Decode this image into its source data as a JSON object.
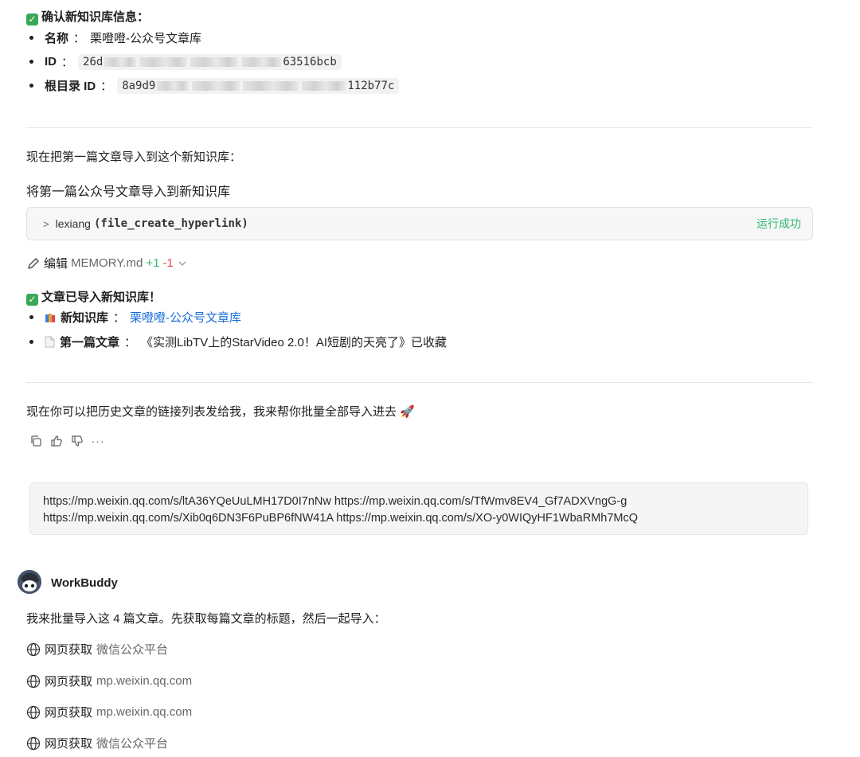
{
  "kb_info": {
    "heading": "确认新知识库信息：",
    "name_label": "名称",
    "name_value": "栗噔噔-公众号文章库",
    "id_label": "ID",
    "id_prefix": "26d",
    "id_suffix": "63516bcb",
    "root_label": "根目录 ID",
    "root_prefix": "8a9d9",
    "root_suffix": "112b77c"
  },
  "colon": "：",
  "msg1": "现在把第一篇文章导入到这个新知识库：",
  "msg2": "将第一篇公众号文章导入到新知识库",
  "tool_call": {
    "chevron": ">",
    "name": "lexiang",
    "fn": "(file_create_hyperlink)",
    "status": "运行成功"
  },
  "edit": {
    "label": "编辑",
    "file": "MEMORY.md",
    "plus": "+1",
    "minus": "-1"
  },
  "imported": {
    "heading": "文章已导入新知识库！",
    "kb_label": "新知识库",
    "kb_value": "栗噔噔-公众号文章库",
    "article_label": "第一篇文章",
    "article_value": "《实测LibTV上的StarVideo 2.0！AI短剧的天亮了》已收藏"
  },
  "msg3": "现在你可以把历史文章的链接列表发给我，我来帮你批量全部导入进去 🚀",
  "user_urls": {
    "line1": "https://mp.weixin.qq.com/s/ltA36YQeUuLMH17D0I7nNw https://mp.weixin.qq.com/s/TfWmv8EV4_Gf7ADXVngG-g",
    "line2": "https://mp.weixin.qq.com/s/Xib0q6DN3F6PuBP6fNW41A https://mp.weixin.qq.com/s/XO-y0WIQyHF1WbaRMh7McQ"
  },
  "assistant": {
    "name": "WorkBuddy",
    "intro": "我来批量导入这 4 篇文章。先获取每篇文章的标题，然后一起导入："
  },
  "fetches": [
    {
      "label": "网页获取",
      "target": "微信公众平台"
    },
    {
      "label": "网页获取",
      "target": "mp.weixin.qq.com"
    },
    {
      "label": "网页获取",
      "target": "mp.weixin.qq.com"
    },
    {
      "label": "网页获取",
      "target": "微信公众平台"
    }
  ],
  "icons": {
    "check": "check-icon",
    "copy": "copy-icon",
    "like": "thumbs-up-icon",
    "dislike": "thumbs-down-icon",
    "more": "more-icon",
    "globe": "globe-icon",
    "pencil": "pencil-icon"
  },
  "colors": {
    "success": "#2eb872",
    "link": "#1a6fd8",
    "check_bg": "#3aa757",
    "minus": "#e5484d"
  }
}
